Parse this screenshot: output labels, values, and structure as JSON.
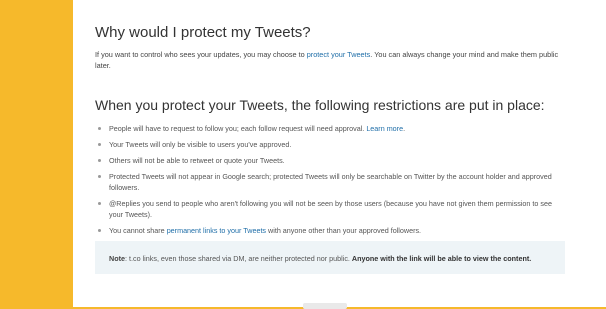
{
  "section1": {
    "title": "Why would I protect my Tweets?",
    "text_before": "If you want to control who sees your updates, you may choose to ",
    "link": "protect your Tweets",
    "text_after": ". You can always change your mind and make them public later."
  },
  "section2": {
    "title": "When you protect your Tweets, the following restrictions are put in place:",
    "items": [
      {
        "before": "People will have to request to follow you; each follow request will need approval. ",
        "link": "Learn more",
        "after": "."
      },
      {
        "before": "Your Tweets will only be visible to users you've approved.",
        "link": "",
        "after": ""
      },
      {
        "before": "Others will not be able to retweet or quote your Tweets.",
        "link": "",
        "after": ""
      },
      {
        "before": "Protected Tweets will not appear in Google search; protected Tweets will only be searchable on Twitter by the account holder and approved followers.",
        "link": "",
        "after": ""
      },
      {
        "before": "@Replies you send to people who aren't following you will not be seen by those users (because you have not given them permission to see your Tweets).",
        "link": "",
        "after": ""
      },
      {
        "before": "You cannot share ",
        "link": "permanent links to your Tweets",
        "after": " with anyone other than your approved followers."
      }
    ]
  },
  "note": {
    "label": "Note",
    "text_mid": ": t.co links, even those shared via DM, are neither protected nor public. ",
    "bold": "Anyone with the link will be able to view the content."
  }
}
